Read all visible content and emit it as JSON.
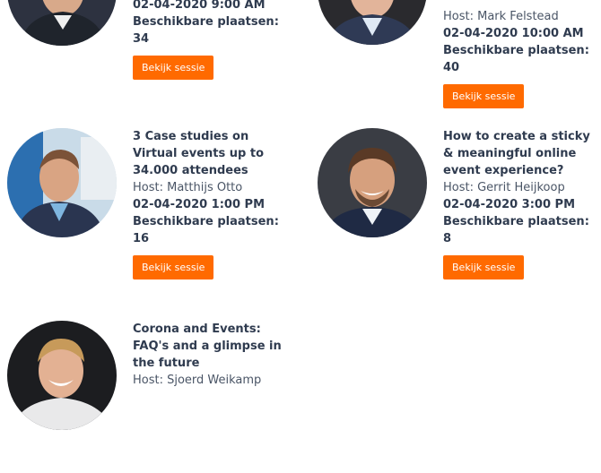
{
  "sessions": [
    {
      "date": "02-04-2020 9:00 AM",
      "seats": "Beschikbare plaatsen: 34",
      "button": "Bekijk sessie"
    },
    {
      "host": "Host: Mark Felstead",
      "date": "02-04-2020 10:00 AM",
      "seats": "Beschikbare plaatsen: 40",
      "button": "Bekijk sessie"
    },
    {
      "title": "3 Case studies on Virtual events up to 34.000 attendees",
      "host": "Host: Matthijs Otto",
      "date": "02-04-2020 1:00 PM",
      "seats": "Beschikbare plaatsen: 16",
      "button": "Bekijk sessie"
    },
    {
      "title": "How to create a sticky & meaningful online event experience?",
      "host": "Host: Gerrit Heijkoop",
      "date": "02-04-2020 3:00 PM",
      "seats": "Beschikbare plaatsen: 8",
      "button": "Bekijk sessie"
    },
    {
      "title": "Corona and Events: FAQ's and a glimpse in the future",
      "host": "Host: Sjoerd Weikamp"
    }
  ],
  "colors": {
    "button": "#ff6a00",
    "text": "#2f3b4f"
  }
}
